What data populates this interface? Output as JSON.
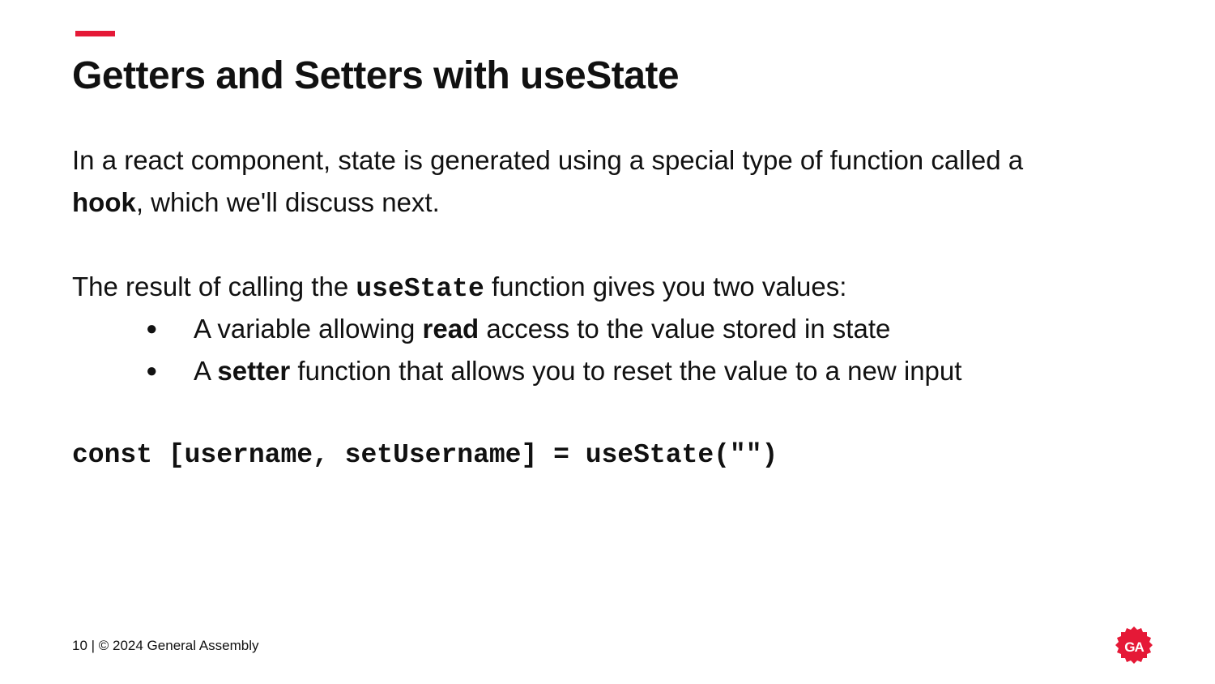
{
  "slide": {
    "title": "Getters and Setters with useState",
    "paragraph1": {
      "text_before": "In a react component, state is generated using a special type of function called a",
      "bold_word": "hook",
      "text_after": ", which we'll discuss next."
    },
    "paragraph2": {
      "text_before": "The result of calling the ",
      "code_word": "useState",
      "text_after": " function gives you two values:"
    },
    "bullets": [
      {
        "marker": "●",
        "prefix": "A variable allowing ",
        "bold": "read",
        "suffix": " access to the value stored in state"
      },
      {
        "marker": "●",
        "prefix": "A ",
        "bold": "setter",
        "suffix": " function that allows you to reset the value to a new input"
      }
    ],
    "code_example": "const [username, setUsername] = useState(\"\")",
    "footer": "10 | © 2024 General Assembly",
    "logo": {
      "text": "GA",
      "icon": "general-assembly-logo-icon",
      "color": "#e51937"
    },
    "accent_color": "#e51937"
  }
}
